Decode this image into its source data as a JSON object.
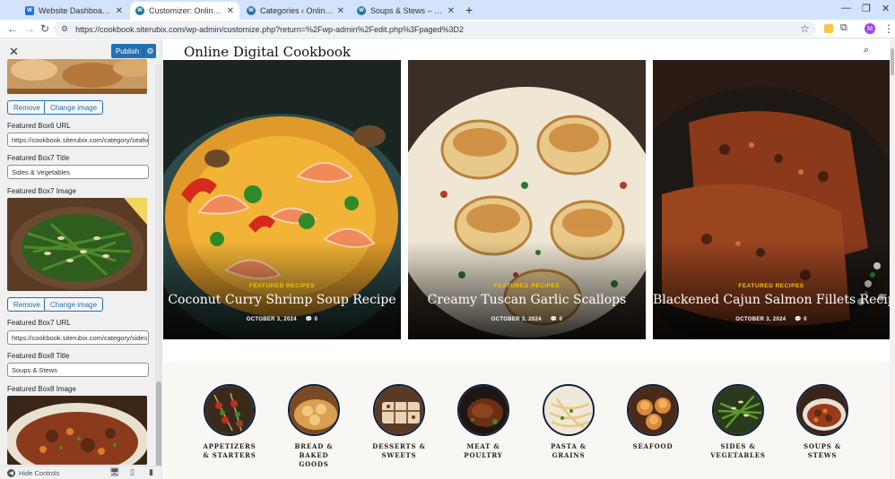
{
  "browser": {
    "tabs": [
      {
        "title": "Website Dashboard - Wealthy",
        "favicon_color": "#1a73e8",
        "favicon_text": "W"
      },
      {
        "title": "Customizer: Online Digital Cook",
        "favicon_color": "#21759b",
        "favicon_text": "W"
      },
      {
        "title": "Categories ‹ Online Digital Co",
        "favicon_color": "#21759b",
        "favicon_text": "W"
      },
      {
        "title": "Soups & Stews – Online Digital",
        "favicon_color": "#21759b",
        "favicon_text": "W"
      }
    ],
    "url": "https://cookbook.siterubix.com/wp-admin/customize.php?return=%2Fwp-admin%2Fedit.php%3Fpaged%3D2",
    "profile_initial": "M"
  },
  "sidebar": {
    "publish_label": "Publish",
    "remove_label": "Remove",
    "change_image_label": "Change image",
    "box6_url_label": "Featured Box6 URL",
    "box6_url_value": "https://cookbook.siterubix.com/category/seafo",
    "box7_title_label": "Featured Box7 Title",
    "box7_title_value": "Sides & Vegetables",
    "box7_image_label": "Featured Box7 Image",
    "box7_url_label": "Featured Box7 URL",
    "box7_url_value": "https://cookbook.siterubix.com/category/sides",
    "box8_title_label": "Featured Box8 Title",
    "box8_title_value": "Soups & Stews",
    "box8_image_label": "Featured Box8 Image",
    "hide_controls": "Hide Controls"
  },
  "preview": {
    "site_title": "Online Digital Cookbook",
    "featured": [
      {
        "category": "FEATURED RECIPES",
        "title": "Coconut Curry Shrimp Soup Recipe",
        "date": "OCTOBER 3, 2024",
        "comments": "0"
      },
      {
        "category": "FEATURED RECIPES",
        "title": "Creamy Tuscan Garlic Scallops",
        "date": "OCTOBER 3, 2024",
        "comments": "0"
      },
      {
        "category": "FEATURED RECIPES",
        "title": "Blackened Cajun Salmon Fillets Recipe",
        "date": "OCTOBER 3, 2024",
        "comments": "0"
      }
    ],
    "categories": [
      {
        "line1": "APPETIZERS",
        "line2": "& STARTERS",
        "line3": ""
      },
      {
        "line1": "BREAD &",
        "line2": "BAKED",
        "line3": "GOODS"
      },
      {
        "line1": "DESSERTS &",
        "line2": "SWEETS",
        "line3": ""
      },
      {
        "line1": "MEAT &",
        "line2": "POULTRY",
        "line3": ""
      },
      {
        "line1": "PASTA &",
        "line2": "GRAINS",
        "line3": ""
      },
      {
        "line1": "SEAFOOD",
        "line2": "",
        "line3": ""
      },
      {
        "line1": "SIDES &",
        "line2": "VEGETABLES",
        "line3": ""
      },
      {
        "line1": "SOUPS &",
        "line2": "STEWS",
        "line3": ""
      }
    ]
  }
}
